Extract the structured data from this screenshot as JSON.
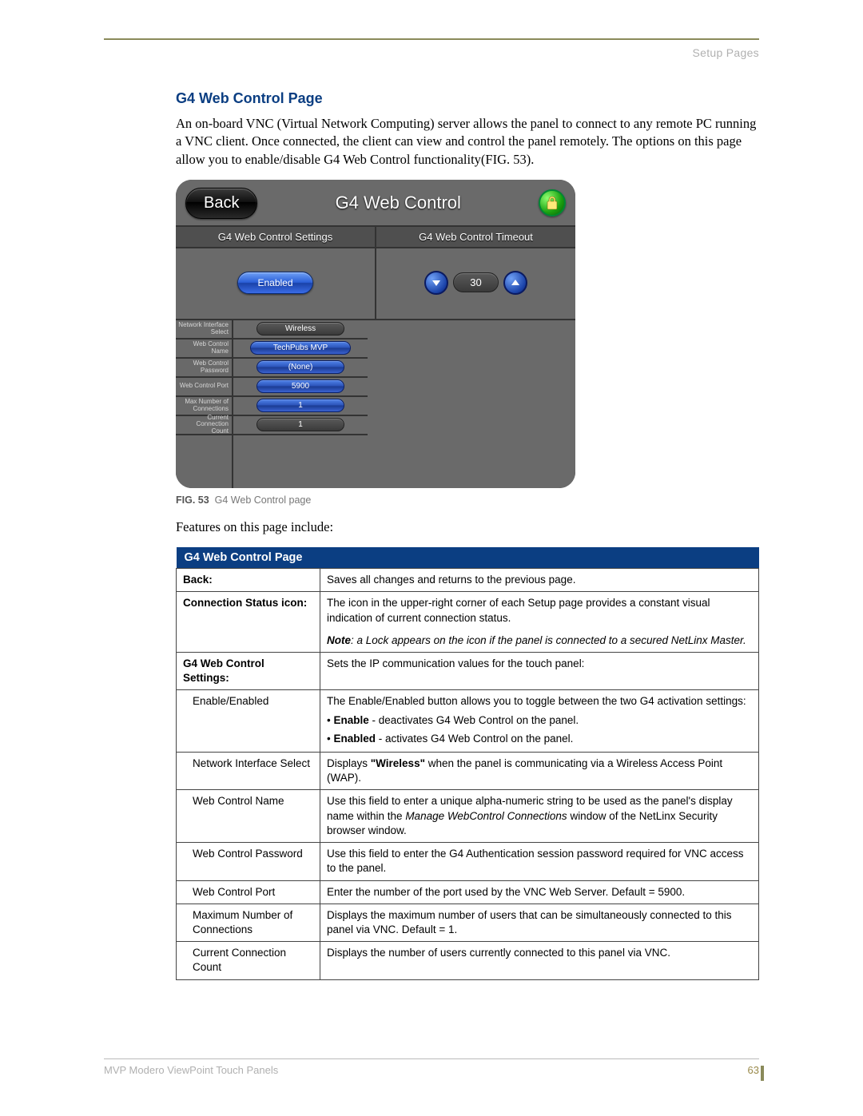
{
  "header": {
    "section": "Setup Pages"
  },
  "heading": "G4 Web Control Page",
  "intro": "An on-board VNC (Virtual Network Computing) server allows the panel to connect to any remote PC running a VNC client. Once connected, the client can view and control the panel remotely. The options on this page allow you to enable/disable G4 Web Control functionality(FIG. 53).",
  "figure": {
    "num": "FIG. 53",
    "caption": "G4 Web Control page"
  },
  "panel": {
    "back": "Back",
    "title": "G4 Web Control",
    "section_left": "G4 Web Control Settings",
    "section_right": "G4 Web Control Timeout",
    "enabled_label": "Enabled",
    "timeout_value": "30",
    "rows": [
      {
        "label": "Network Interface Select",
        "value": "Wireless",
        "blue": false
      },
      {
        "label": "Web Control Name",
        "value": "TechPubs MVP",
        "blue": true
      },
      {
        "label": "Web Control Password",
        "value": "(None)",
        "blue": true
      },
      {
        "label": "Web Control Port",
        "value": "5900",
        "blue": true
      },
      {
        "label": "Max Number of Connections",
        "value": "1",
        "blue": true
      },
      {
        "label": "Current Connection Count",
        "value": "1",
        "blue": false
      }
    ]
  },
  "features_intro": "Features on this page include:",
  "table": {
    "header": "G4 Web Control Page",
    "rows": {
      "back_label": "Back:",
      "back_desc": "Saves all changes and returns to the previous page.",
      "conn_label": "Connection Status icon:",
      "conn_desc": "The icon in the upper-right corner of each Setup page provides a constant visual indication of current connection status.",
      "conn_note_prefix": "Note",
      "conn_note_rest": ": a Lock appears on the icon if the panel is connected to a secured NetLinx Master.",
      "settings_label": "G4 Web Control Settings:",
      "settings_desc": "Sets the IP communication values for the touch panel:",
      "enable_label": "Enable/Enabled",
      "enable_desc": "The Enable/Enabled button allows you to toggle between the two G4 activation settings:",
      "enable_b1a": "Enable",
      "enable_b1b": " - deactivates G4 Web Control on the panel.",
      "enable_b2a": "Enabled",
      "enable_b2b": " - activates G4 Web Control on the panel.",
      "nis_label": "Network Interface Select",
      "nis_pre": "Displays ",
      "nis_bold": "\"Wireless\"",
      "nis_post": " when the panel is communicating via a Wireless Access Point (WAP).",
      "wcn_label": "Web Control Name",
      "wcn_pre": "Use this field to enter a unique alpha-numeric string to be used as the panel's display name within the ",
      "wcn_italic": "Manage WebControl Connections",
      "wcn_post": " window of the NetLinx Security browser window.",
      "wcp_label": "Web Control Password",
      "wcp_desc": "Use this field to enter the G4 Authentication session password required for VNC access to the panel.",
      "port_label": "Web Control Port",
      "port_desc": "Enter the number of the port used by the VNC Web Server. Default = 5900.",
      "max_label": "Maximum Number of Connections",
      "max_desc": "Displays the maximum number of users that can be simultaneously connected to this panel via VNC. Default = 1.",
      "cur_label": "Current Connection Count",
      "cur_desc": "Displays the number of users currently connected to this panel via VNC."
    }
  },
  "footer": {
    "product": "MVP Modero ViewPoint Touch Panels",
    "page": "63"
  }
}
